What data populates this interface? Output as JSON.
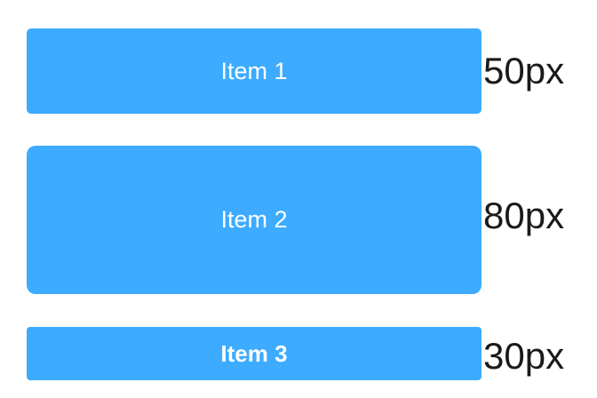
{
  "items": [
    {
      "label": "Item 1",
      "size_label": "50px"
    },
    {
      "label": "Item 2",
      "size_label": "80px"
    },
    {
      "label": "Item 3",
      "size_label": "30px"
    }
  ],
  "colors": {
    "item_fill": "#3dabff",
    "item_text": "#ffffff",
    "size_text": "#1a1a1a",
    "background": "#ffffff"
  }
}
